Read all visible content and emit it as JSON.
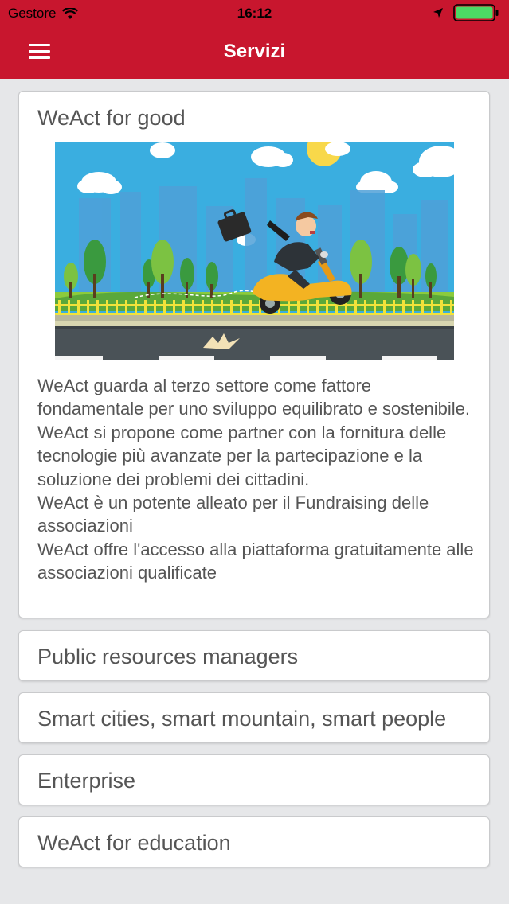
{
  "status_bar": {
    "carrier": "Gestore",
    "time": "16:12"
  },
  "nav": {
    "title": "Servizi"
  },
  "services": [
    {
      "title": "WeAct for good",
      "expanded": true,
      "description": [
        "WeAct guarda al terzo settore come fattore fondamentale per uno sviluppo equilibrato e sostenibile. WeAct si propone come partner con la fornitura delle tecnologie più avanzate per la partecipazione e la soluzione dei problemi dei cittadini.",
        "WeAct è un potente alleato per il Fundraising delle associazioni",
        "WeAct offre l'accesso alla piattaforma gratuitamente alle associazioni qualificate"
      ]
    },
    {
      "title": "Public resources managers",
      "expanded": false
    },
    {
      "title": "Smart cities, smart mountain, smart people",
      "expanded": false
    },
    {
      "title": "Enterprise",
      "expanded": false
    },
    {
      "title": "WeAct for education",
      "expanded": false
    }
  ],
  "colors": {
    "header": "#c8162e",
    "background": "#e6e7e9",
    "text": "#555555",
    "battery": "#4cd964"
  },
  "icons": {
    "menu": "hamburger-menu-icon",
    "wifi": "wifi-icon",
    "location": "location-arrow-icon",
    "battery": "battery-icon"
  }
}
